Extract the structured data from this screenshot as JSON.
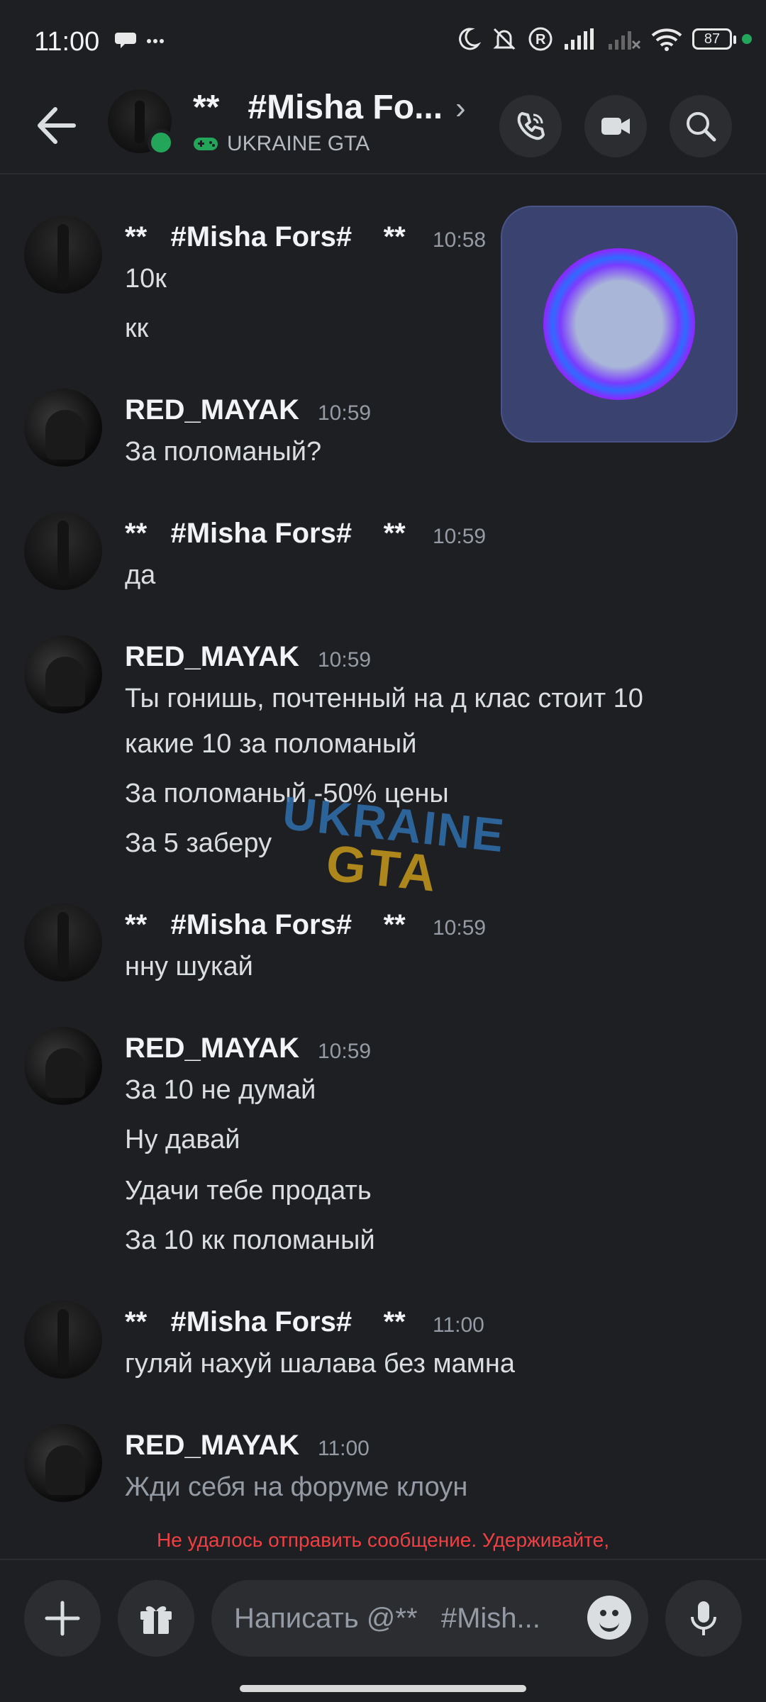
{
  "status_bar": {
    "time": "11:00",
    "battery": "87"
  },
  "header": {
    "title": "**   #Misha Fo...",
    "subtitle": "UKRAINE GTA"
  },
  "embed": {
    "description": ""
  },
  "messages": [
    {
      "author": "**   #Misha Fors#    **",
      "time": "10:58",
      "lines": [
        "10к",
        "кк"
      ]
    },
    {
      "author": "RED_MAYAK",
      "time": "10:59",
      "lines": [
        "За поломаный?"
      ]
    },
    {
      "author": "**   #Misha Fors#    **",
      "time": "10:59",
      "lines": [
        "да"
      ]
    },
    {
      "author": "RED_MAYAK",
      "time": "10:59",
      "lines": [
        "Ты гонишь, почтенный на д клас стоит 10",
        "какие 10 за поломаный",
        "За поломаный -50% цены",
        "За 5 заберу"
      ]
    },
    {
      "author": "**   #Misha Fors#    **",
      "time": "10:59",
      "lines": [
        "нну шукай"
      ]
    },
    {
      "author": "RED_MAYAK",
      "time": "10:59",
      "lines": [
        "За 10 не думай",
        "Ну давай",
        "Удачи тебе продать",
        "За 10 кк поломаный"
      ]
    },
    {
      "author": "**   #Misha Fors#    **",
      "time": "11:00",
      "lines": [
        "гуляй нахуй шалава без мамна"
      ]
    },
    {
      "author": "RED_MAYAK",
      "time": "11:00",
      "lines": [
        "Жди себя на форуме клоун"
      ]
    }
  ],
  "watermark": {
    "line1": "UKRAINE",
    "line2": "GTA"
  },
  "error_text": "Не удалось отправить сообщение. Удерживайте,",
  "composer": {
    "placeholder": "Написать @**   #Mish..."
  },
  "colors": {
    "background": "#1e1f22",
    "online": "#23a55a",
    "error": "#f23f43"
  },
  "icons": [
    "back-arrow-icon",
    "phone-icon",
    "video-camera-icon",
    "search-icon",
    "plus-icon",
    "gift-icon",
    "emoji-icon",
    "microphone-icon",
    "gamepad-icon"
  ]
}
